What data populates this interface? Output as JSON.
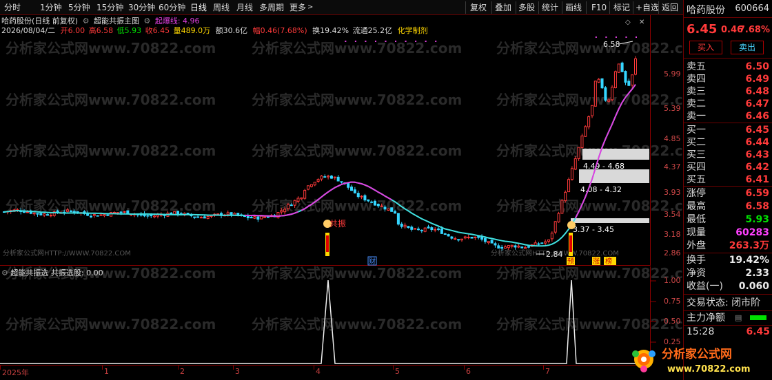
{
  "toolbar": {
    "periods": [
      "分时",
      "1分钟",
      "5分钟",
      "15分钟",
      "30分钟",
      "60分钟",
      "日线",
      "周线",
      "月线",
      "多周期",
      "更多"
    ],
    "tools": [
      "复权",
      "叠加",
      "多股",
      "统计",
      "画线",
      "F10",
      "标记",
      "+自选",
      "返回"
    ]
  },
  "chart_header": {
    "stock": "哈药股份(日线 前复权)",
    "indicator": "超能共振主图",
    "line_label": "起爆线: 4.96",
    "date": "2026/08/04/二",
    "open": "开6.00",
    "high": "高6.58",
    "low": "低5.93",
    "close": "收6.45",
    "volume": "量489.0万",
    "amount": "额30.6亿",
    "amp": "幅0.46(7.68%)",
    "turnover": "换19.42%",
    "float": "流通25.2亿",
    "sector": "化学制剂"
  },
  "price_axis": [
    "5.99",
    "5.39",
    "4.85",
    "4.37",
    "3.93",
    "3.54",
    "3.18",
    "2.86"
  ],
  "sub_axis": [
    "1.00",
    "0.75",
    "0.50",
    "0.25"
  ],
  "sub_panel_title": "超能共振选 共振选股: 0.00",
  "date_axis": [
    "2025年",
    "1",
    "2",
    "3",
    "4",
    "5",
    "6",
    "7"
  ],
  "annotations": {
    "high_label": "6.58",
    "low_label": "2.84",
    "zone1": "4.49 - 4.68",
    "zone2": "4.08 - 4.32",
    "zone3": "3.37 - 3.45",
    "signal": "共振",
    "tag_cai": "财",
    "tag_yu": "预",
    "tag_zhang": "涨",
    "tag_bang": "榜"
  },
  "watermark": "分析家公式网www.70822.com",
  "watermark_small": "分析家公式网HTTP://WWW.70822.COM",
  "quote": {
    "name": "哈药股份",
    "code": "600664",
    "price": "6.45",
    "change": "0.46",
    "pct": "7.68%",
    "buy_btn": "买入",
    "sell_btn": "卖出",
    "asks": [
      {
        "label": "卖五",
        "value": "6.50"
      },
      {
        "label": "卖四",
        "value": "6.49"
      },
      {
        "label": "卖三",
        "value": "6.48"
      },
      {
        "label": "卖二",
        "value": "6.47"
      },
      {
        "label": "卖一",
        "value": "6.46"
      }
    ],
    "bids": [
      {
        "label": "买一",
        "value": "6.45"
      },
      {
        "label": "买二",
        "value": "6.44"
      },
      {
        "label": "买三",
        "value": "6.43"
      },
      {
        "label": "买四",
        "value": "6.42"
      },
      {
        "label": "买五",
        "value": "6.41"
      }
    ],
    "stats1": [
      {
        "label": "涨停",
        "value": "6.59"
      },
      {
        "label": "最高",
        "value": "6.58"
      },
      {
        "label": "最低",
        "value": "5.93"
      },
      {
        "label": "现量",
        "value": "60283"
      },
      {
        "label": "外盘",
        "value": "263.3万"
      }
    ],
    "stats2": [
      {
        "label": "换手",
        "value": "19.42%"
      },
      {
        "label": "净资",
        "value": "2.33"
      },
      {
        "label": "收益(一)",
        "value": "0.060"
      }
    ],
    "trade_status": "交易状态: 闭市阶",
    "main_flow": "主力净额",
    "time": "15:28",
    "time_price": "6.45"
  },
  "logo_text": "分析家公式网",
  "logo_url": "www.70822.com",
  "colors": {
    "up": "#ff3a3a",
    "down": "#35d6ff",
    "ma": "#40e0e0",
    "line": "#e040e0"
  }
}
